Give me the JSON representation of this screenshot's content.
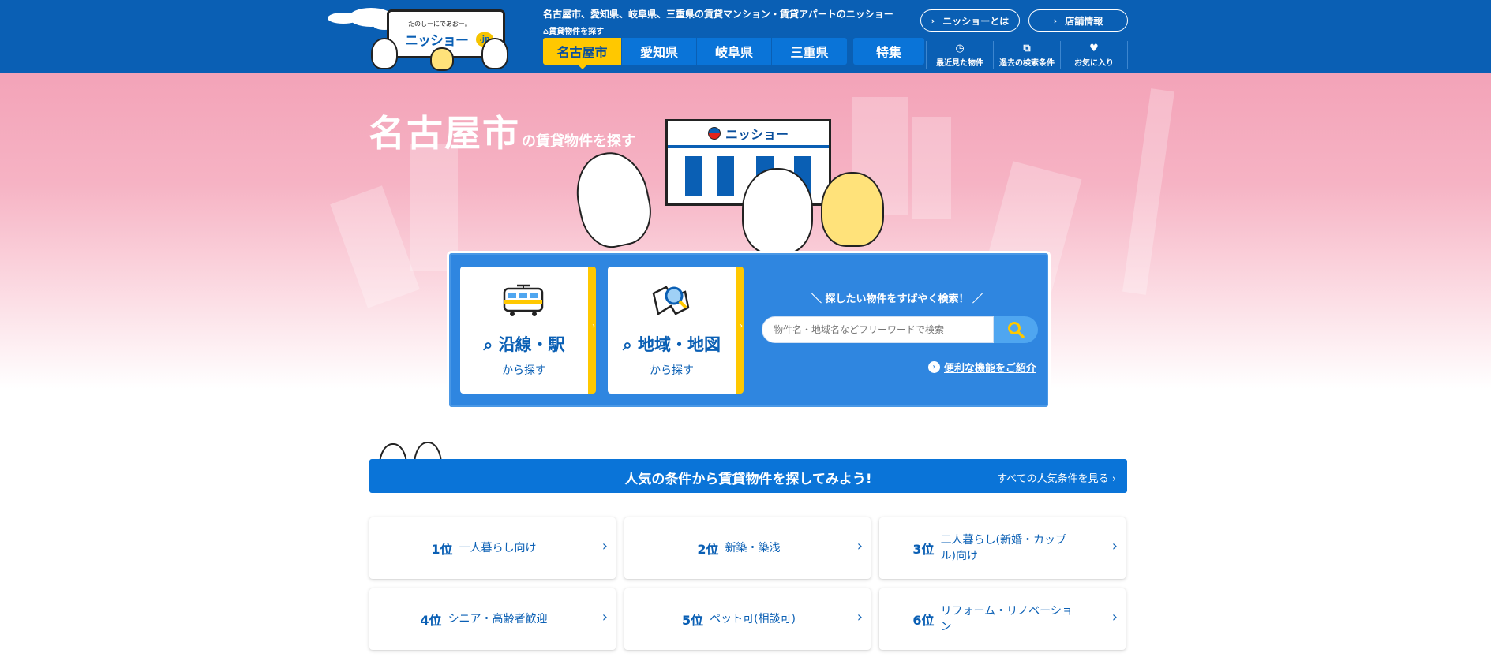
{
  "header": {
    "logo_tagline": "たのしーにであおー。",
    "logo_text": "ニッショー",
    "logo_suffix": ".jp",
    "tagline": "名古屋市、愛知県、岐阜県、三重県の賃貸マンション・賃貸アパートのニッショー",
    "subnav_label": "賃貸物件を探す",
    "tabs": [
      {
        "label": "名古屋市",
        "active": true
      },
      {
        "label": "愛知県"
      },
      {
        "label": "岐阜県"
      },
      {
        "label": "三重県"
      }
    ],
    "special_tab": "特集",
    "links": [
      {
        "label": "ニッショーとは"
      },
      {
        "label": "店舗情報"
      }
    ],
    "tools": [
      {
        "label": "最近見た物件",
        "icon": "clock-icon"
      },
      {
        "label": "過去の検索条件",
        "icon": "history-copy-icon"
      },
      {
        "label": "お気に入り",
        "icon": "heart-icon"
      }
    ],
    "colors": {
      "primary": "#0a5fb4",
      "accent": "#ffc800"
    }
  },
  "hero": {
    "title_big": "名古屋市",
    "title_small": "の賃貸物件を探す",
    "store_sign": "ニッショー"
  },
  "search": {
    "cards": [
      {
        "title": "沿線・駅",
        "sub": "から探す",
        "icon": "train-icon"
      },
      {
        "title": "地域・地図",
        "sub": "から探す",
        "icon": "map-search-icon"
      }
    ],
    "prompt": "＼  探したい物件をすばやく検索！ ／",
    "placeholder": "物件名・地域名などフリーワードで検索",
    "feature_link": "便利な機能をご紹介"
  },
  "popular": {
    "title": "人気の条件から賃貸物件を探してみよう!",
    "all_link": "すべての人気条件を見る",
    "items": [
      {
        "rank": "1位",
        "label": "一人暮らし向け"
      },
      {
        "rank": "2位",
        "label": "新築・築浅"
      },
      {
        "rank": "3位",
        "label": "二人暮らし(新婚・カップル)向け"
      },
      {
        "rank": "4位",
        "label": "シニア・高齢者歓迎"
      },
      {
        "rank": "5位",
        "label": "ペット可(相談可)"
      },
      {
        "rank": "6位",
        "label": "リフォーム・リノベーション"
      }
    ]
  }
}
